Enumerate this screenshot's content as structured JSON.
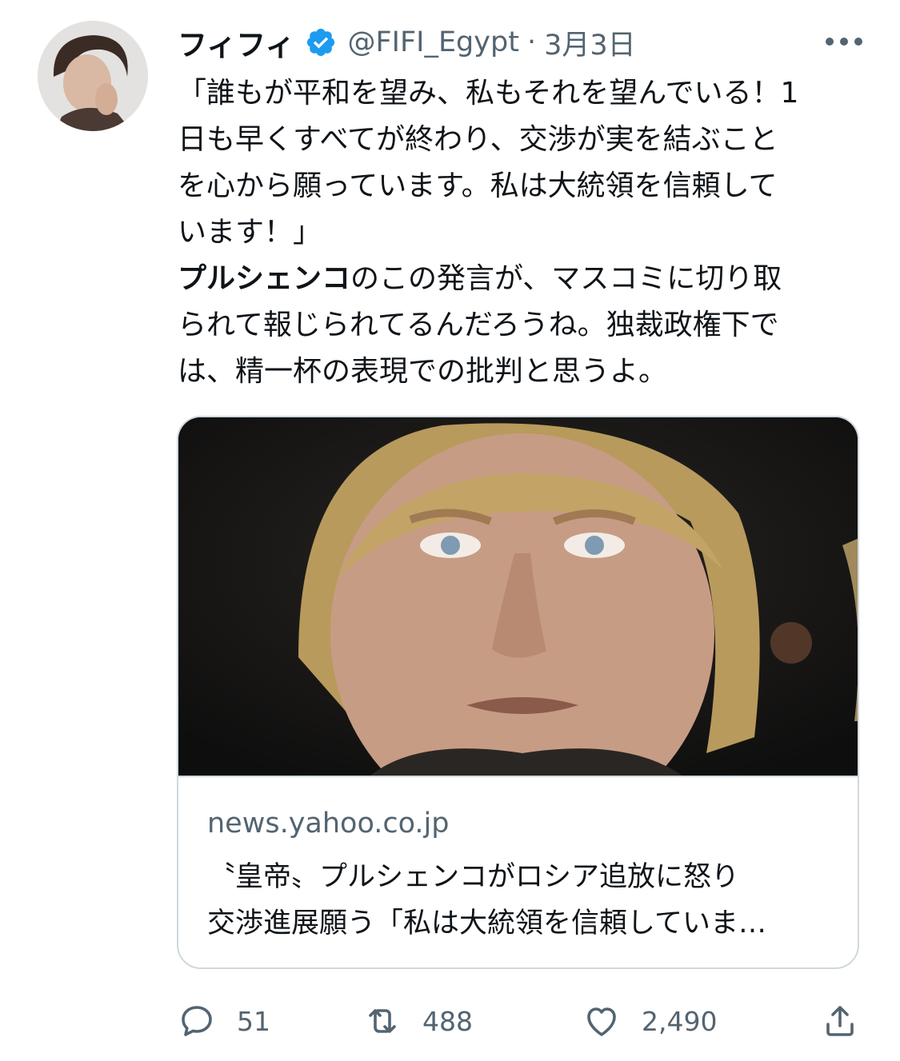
{
  "tweet": {
    "author_name": "フィフィ",
    "handle": "@FIFI_Egypt",
    "separator": "·",
    "date": "3月3日",
    "text_lines": [
      "「誰もが平和を望み、私もそれを望んでいる！1",
      "日も早くすべてが終わり、交渉が実を結ぶこと",
      "を心から願っています。私は大統領を信頼して",
      "います！」"
    ],
    "bold_word": "プルシェンコ",
    "text_after_bold": "のこの発言が、マスコミに切り取",
    "text_lines_2": [
      "られて報じられてるんだろうね。独裁政権下で",
      "は、精一杯の表現での批判と思うよ。"
    ]
  },
  "card": {
    "domain": "news.yahoo.co.jp",
    "title_lines": [
      "〝皇帝〟プルシェンコがロシア追放に怒り",
      "交渉進展願う「私は大統領を信頼していま…"
    ]
  },
  "actions": {
    "replies": "51",
    "retweets": "488",
    "likes": "2,490"
  },
  "colors": {
    "verified": "#1d9bf0",
    "secondary": "#536471",
    "border": "#cfd9de"
  },
  "icons": [
    "verified-badge-icon",
    "more-icon",
    "reply-icon",
    "retweet-icon",
    "like-icon",
    "share-icon"
  ]
}
